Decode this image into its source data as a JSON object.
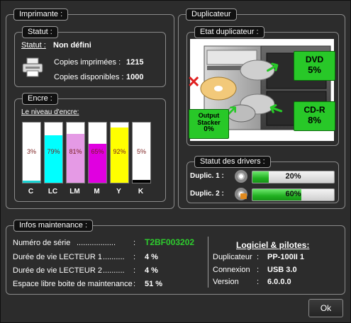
{
  "printer": {
    "group_title": "Imprimante :",
    "status_group_title": "Statut :",
    "status_label": "Statut :",
    "status_value": "Non défini",
    "printed_label": "Copies imprimées :",
    "printed_value": "1215",
    "available_label": "Copies disponibles :",
    "available_value": "1000",
    "printer_icon": "printer-icon"
  },
  "ink": {
    "group_title": "Encre :",
    "level_label": "Le niveau d'encre:",
    "cartridges": [
      {
        "name": "C",
        "percent_label": "3%",
        "level": 3,
        "color": "#19d2d2"
      },
      {
        "name": "LC",
        "percent_label": "79%",
        "level": 79,
        "color": "#00ffff"
      },
      {
        "name": "LM",
        "percent_label": "81%",
        "level": 81,
        "color": "#e59ae5"
      },
      {
        "name": "M",
        "percent_label": "65%",
        "level": 65,
        "color": "#e000e0"
      },
      {
        "name": "Y",
        "percent_label": "92%",
        "level": 92,
        "color": "#ffff00"
      },
      {
        "name": "K",
        "percent_label": "5%",
        "level": 5,
        "color": "#000000"
      }
    ]
  },
  "duplicator": {
    "group_title": "Duplicateur",
    "state_group_title": "Etat duplicateur :",
    "dvd_label": "DVD",
    "dvd_value": "5%",
    "cdr_label": "CD-R",
    "cdr_value": "8%",
    "output_label_1": "Output",
    "output_label_2": "Stacker",
    "output_value": "0%",
    "drivers_group_title": "Statut des drivers :",
    "drivers": [
      {
        "label": "Duplic. 1 :",
        "percent_label": "20%",
        "level": 20
      },
      {
        "label": "Duplic. 2 :",
        "percent_label": "60%",
        "level": 60
      }
    ]
  },
  "maintenance": {
    "group_title": "Infos maintenance :",
    "serial_label": "Numéro de série",
    "serial_dots": "..................",
    "serial_value": "T2BF003202",
    "serial_color": "#2ecc2e",
    "drive1_label": "Durée de vie LECTEUR 1",
    "drive1_dots": "..........",
    "drive1_value": "4 %",
    "drive2_label": "Durée de vie LECTEUR 2",
    "drive2_dots": "..........",
    "drive2_value": "4 %",
    "box_label": "Espace libre boite de maintenance",
    "box_value": "51 %",
    "colon": ":"
  },
  "software": {
    "title": "Logiciel & pilotes:",
    "rows": [
      {
        "label": "Duplicateur",
        "value": "PP-100II 1"
      },
      {
        "label": "Connexion",
        "value": "USB 3.0"
      },
      {
        "label": "Version",
        "value": "6.0.0.0"
      }
    ],
    "colon": ":"
  },
  "ok_label": "Ok"
}
